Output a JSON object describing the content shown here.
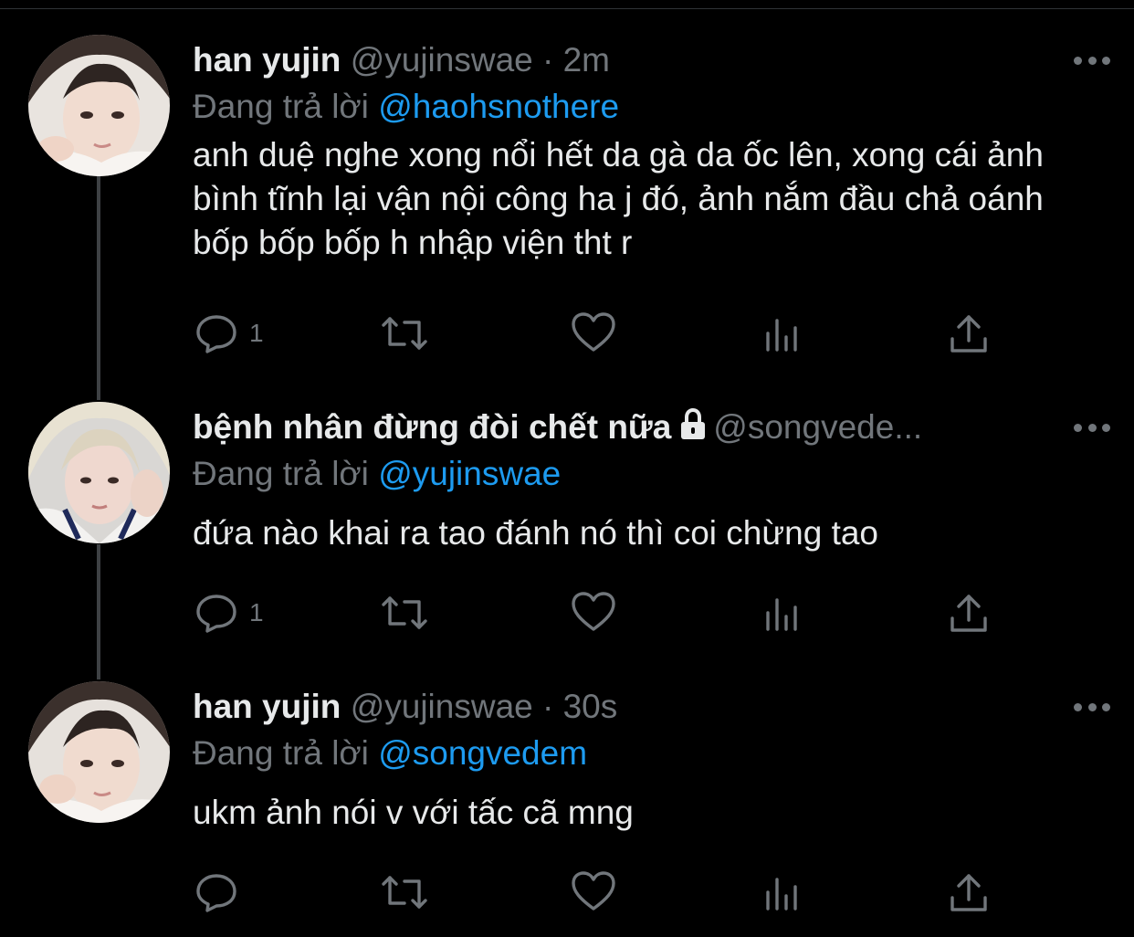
{
  "tweets": [
    {
      "name": "han yujin",
      "handle": "@yujinswae",
      "separator": "·",
      "time": "2m",
      "reply_prefix": "Đang trả lời",
      "reply_to": "@haohsnothere",
      "text": "anh duệ nghe xong nổi hết da gà da ốc lên, xong cái ảnh bình tĩnh lại vận nội công ha j đó, ảnh nắm đầu chả oánh bốp bốp bốp h nhập viện tht r",
      "reply_count": "1",
      "locked": false
    },
    {
      "name": "bệnh nhân đừng đòi chết nữa",
      "handle": "@songvede...",
      "separator": "",
      "time": "",
      "reply_prefix": "Đang trả lời",
      "reply_to": "@yujinswae",
      "text": "đứa nào khai ra tao đánh nó thì coi chừng tao",
      "reply_count": "1",
      "locked": true
    },
    {
      "name": "han yujin",
      "handle": "@yujinswae",
      "separator": "·",
      "time": "30s",
      "reply_prefix": "Đang trả lời",
      "reply_to": "@songvedem",
      "text": "ukm ảnh nói v với tấc cã mng",
      "reply_count": "",
      "locked": false
    }
  ],
  "icons": {
    "reply": "reply-icon",
    "retweet": "retweet-icon",
    "like": "heart-icon",
    "views": "analytics-icon",
    "share": "share-icon",
    "more": "more-icon",
    "lock": "lock-icon"
  },
  "colors": {
    "background": "#000000",
    "text": "#e7e9ea",
    "muted": "#71767b",
    "mention": "#1d9bf0",
    "thread_line": "#3e4144"
  }
}
